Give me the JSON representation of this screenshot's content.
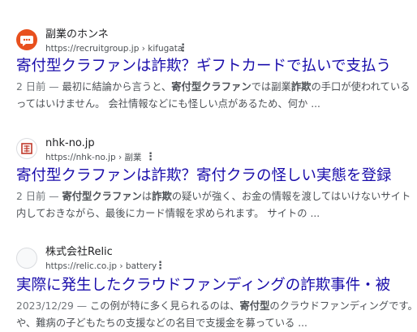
{
  "results": [
    {
      "favicon_icon": "chat-bubble-icon",
      "favicon_color": "#e8501e",
      "site_name": "副業のホンネ",
      "url": "https://recruitgroup.jp › kifugata",
      "title": "寄付型クラファンは詐欺？ギフトカードで払いで支払う",
      "snippet_line1": [
        {
          "t": "2 日前 — ",
          "style": "date"
        },
        {
          "t": "最初に結論から言うと、",
          "style": "normal"
        },
        {
          "t": "寄付型クラファン",
          "style": "bold"
        },
        {
          "t": "では副業",
          "style": "normal"
        },
        {
          "t": "詐欺",
          "style": "bold"
        },
        {
          "t": "の手口が使われている",
          "style": "normal"
        }
      ],
      "snippet_line2": [
        {
          "t": "ってはいけません。 会社情報などにも怪しい点があるため、何か ...",
          "style": "normal"
        }
      ]
    },
    {
      "favicon_icon": "red-seal-icon",
      "favicon_color": "#c0392b",
      "site_name": "nhk-no.jp",
      "url": "https://nhk-no.jp › 副業",
      "title": "寄付型クラファンは詐欺？寄付クラの怪しい実態を登録",
      "snippet_line1": [
        {
          "t": "2 日前 — ",
          "style": "date"
        },
        {
          "t": "寄付型クラファン",
          "style": "bold"
        },
        {
          "t": "は",
          "style": "normal"
        },
        {
          "t": "詐欺",
          "style": "bold"
        },
        {
          "t": "の疑いが強く、お金の情報を渡してはいけないサイト",
          "style": "normal"
        }
      ],
      "snippet_line2": [
        {
          "t": "内しておきながら、最後にカード情報を求められます。 サイトの ...",
          "style": "normal"
        }
      ]
    },
    {
      "favicon_icon": "blank-circle-icon",
      "favicon_color": "#dadce0",
      "site_name": "株式会社Relic",
      "url": "https://relic.co.jp › battery",
      "title": "実際に発生したクラウドファンディングの詐欺事件・被",
      "snippet_line1": [
        {
          "t": "2023/12/29 — ",
          "style": "date"
        },
        {
          "t": "この例が特に多く見られるのは、",
          "style": "normal"
        },
        {
          "t": "寄付型",
          "style": "bold"
        },
        {
          "t": "のクラウドファンディングです。",
          "style": "normal"
        }
      ],
      "snippet_line2": [
        {
          "t": "や、難病の子どもたちの支援などの名目で支援金を募っている ...",
          "style": "normal"
        }
      ]
    }
  ],
  "more_options_glyph": "⋮"
}
